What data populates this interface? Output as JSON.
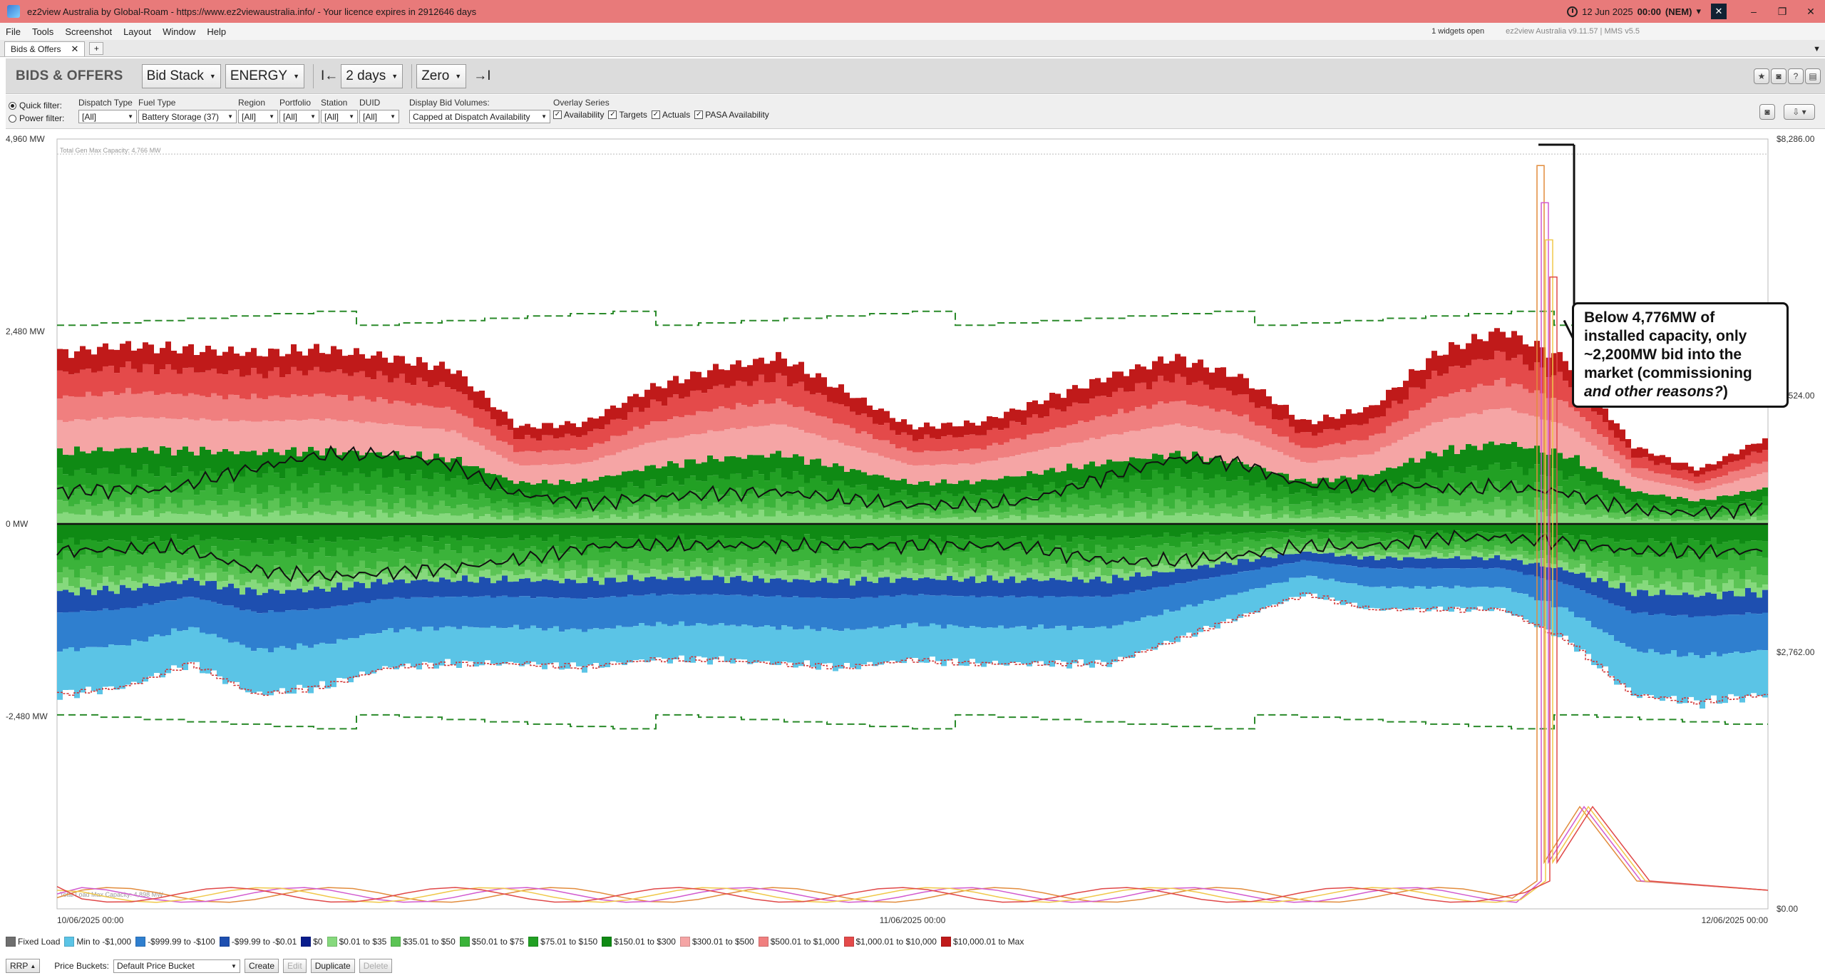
{
  "titlebar": {
    "title": "ez2view Australia by Global-Roam - https://www.ez2viewaustralia.info/ - Your licence expires in 2912646 days",
    "date": "12 Jun 2025",
    "time": "00:00",
    "market": "(NEM)",
    "minimize": "–",
    "restore": "❐",
    "close": "✕",
    "mute": "✕"
  },
  "menu": {
    "items": [
      "File",
      "Tools",
      "Screenshot",
      "Layout",
      "Window",
      "Help"
    ],
    "widgets_open": "1 widgets open",
    "version": "ez2view Australia v9.11.57 | MMS v5.5"
  },
  "tabs": {
    "active": "Bids & Offers",
    "close": "✕",
    "add": "+",
    "chevron": "▼"
  },
  "widget": {
    "title": "BIDS & OFFERS",
    "view": "Bid Stack",
    "market": "ENERGY",
    "prev_icon": "I←",
    "span": "2 days",
    "next_icon": "→I",
    "zero": "Zero"
  },
  "filters": {
    "quick_filter": "Quick filter:",
    "power_filter": "Power filter:",
    "dispatch_type_label": "Dispatch Type",
    "dispatch_type_value": "[All]",
    "fuel_type_label": "Fuel Type",
    "fuel_type_value": "Battery Storage (37)",
    "region_label": "Region",
    "region_value": "[All]",
    "portfolio_label": "Portfolio",
    "portfolio_value": "[All]",
    "station_label": "Station",
    "station_value": "[All]",
    "duid_label": "DUID",
    "duid_value": "[All]",
    "display_bid_volumes_label": "Display Bid Volumes:",
    "display_bid_volumes_value": "Capped at Dispatch Availability",
    "overlay_label": "Overlay Series",
    "overlay_items": [
      "Availability",
      "Targets",
      "Actuals",
      "PASA Availability"
    ]
  },
  "annotation": {
    "line1": "Below 4,776MW of",
    "line2": "installed capacity, only",
    "line3": "~2,200MW bid into the",
    "line4": "market (commissioning",
    "line5_italic": "and other reasons?",
    "line5_end": ")"
  },
  "chart_data": {
    "type": "area",
    "title": "",
    "y_left_ticks": [
      "4,960 MW",
      "2,480 MW",
      "0 MW",
      "-2,480 MW"
    ],
    "y_left_range": [
      -4960,
      4960
    ],
    "y_right_ticks": [
      "$8,286.00",
      "$5,524.00",
      "$2,762.00",
      "$0.00"
    ],
    "y_right_range": [
      0,
      8286
    ],
    "x_ticks": [
      "10/06/2025 00:00",
      "11/06/2025 00:00",
      "12/06/2025 00:00"
    ],
    "capacity_note": "Total Gen Max Capacity: 4,766 MW",
    "load_note": "Total Load Max Capacity: 4,898 MW",
    "upper_stack_top_mw": [
      2200,
      2300,
      2250,
      2200,
      2250,
      2150,
      2000,
      1250,
      1300,
      1750,
      2000,
      2150,
      1700,
      1250,
      1300,
      1600,
      1900,
      2150,
      1900,
      1300,
      1500,
      2200,
      2500,
      2100,
      1000,
      700,
      1100
    ],
    "lower_stack_bottom_mw": [
      -2200,
      -2100,
      -1800,
      -2200,
      -2100,
      -1850,
      -1800,
      -1800,
      -1850,
      -1750,
      -1750,
      -1800,
      -1850,
      -1750,
      -1800,
      -1800,
      -1800,
      -1500,
      -1200,
      -900,
      -1100,
      -1100,
      -1100,
      -1500,
      -2200,
      -2300,
      -2200
    ],
    "availability_upper_mw": 2650,
    "availability_lower_mw": -2550,
    "price_spike_rrp": 8000,
    "series": [
      {
        "name": "Fixed Load",
        "color": "#6e6e6e"
      },
      {
        "name": "Min to -$1,000",
        "color": "#5bc4e6"
      },
      {
        "name": "-$999.99 to -$100",
        "color": "#2f7fcf"
      },
      {
        "name": "-$99.99 to -$0.01",
        "color": "#1e4fb0"
      },
      {
        "name": "$0",
        "color": "#0a1d8c"
      },
      {
        "name": "$0.01 to $35",
        "color": "#86d97d"
      },
      {
        "name": "$35.01 to $50",
        "color": "#5cc455"
      },
      {
        "name": "$50.01 to $75",
        "color": "#3bb33a"
      },
      {
        "name": "$75.01 to $150",
        "color": "#22a024"
      },
      {
        "name": "$150.01 to $300",
        "color": "#0f8a14"
      },
      {
        "name": "$300.01 to $500",
        "color": "#f5a5a5"
      },
      {
        "name": "$500.01 to $1,000",
        "color": "#f07f7f"
      },
      {
        "name": "$1,000.01 to $10,000",
        "color": "#e44a4a"
      },
      {
        "name": "$10,000.01 to Max",
        "color": "#c01a1a"
      }
    ]
  },
  "bottom": {
    "rrp": "RRP",
    "price_buckets_label": "Price Buckets:",
    "price_buckets_value": "Default Price Bucket",
    "create": "Create",
    "edit": "Edit",
    "duplicate": "Duplicate",
    "delete": "Delete"
  }
}
